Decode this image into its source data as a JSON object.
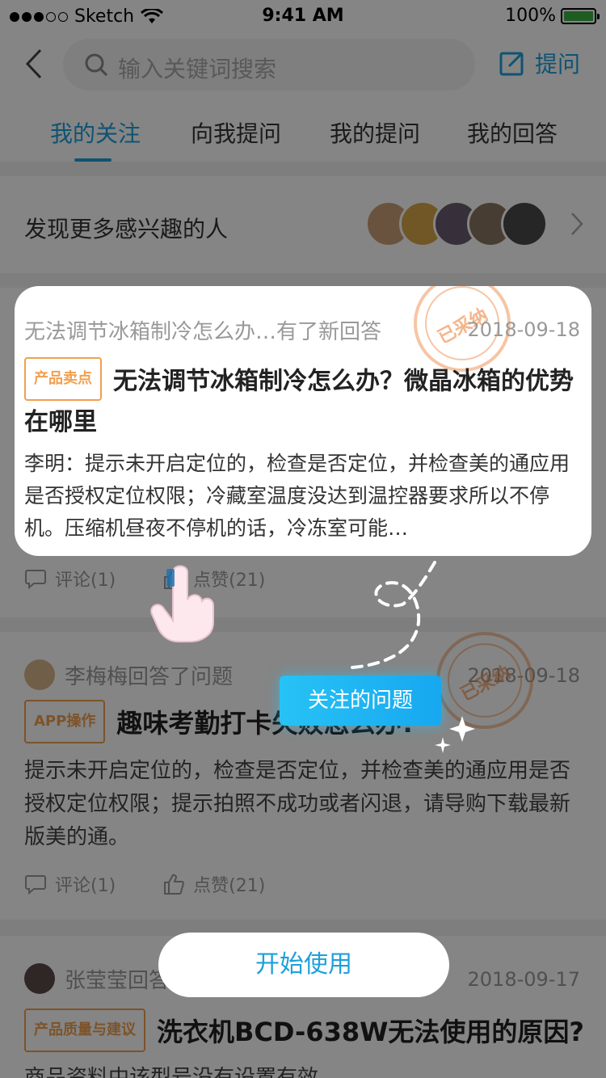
{
  "status_bar": {
    "carrier": "Sketch",
    "time": "9:41 AM",
    "battery": "100%"
  },
  "header": {
    "search_placeholder": "输入关键词搜索",
    "ask_label": "提问"
  },
  "tabs": [
    {
      "label": "我的关注",
      "active": true
    },
    {
      "label": "向我提问",
      "active": false
    },
    {
      "label": "我的提问",
      "active": false
    },
    {
      "label": "我的回答",
      "active": false
    }
  ],
  "discover": {
    "label": "发现更多感兴趣的人"
  },
  "feed": [
    {
      "head": "无法调节冰箱制冷怎么办…有了新回答",
      "date": "2018-09-18",
      "tag": "产品卖点",
      "title": "无法调节冰箱制冷怎么办？微晶冰箱的优势在哪里",
      "body": "李明：提示未开启定位的，检查是否定位，并检查美的通应用是否授权定位权限；冷藏室温度没达到温控器要求所以不停机。压缩机昼夜不停机的话，冷冻室可能…",
      "comments": "评论(1)",
      "likes": "点赞(21)",
      "stamp": "已采纳"
    },
    {
      "head": "李梅梅回答了问题",
      "date": "2018-09-18",
      "tag": "APP操作",
      "title": "趣味考勤打卡失败怎么办?",
      "body": "提示未开启定位的，检查是否定位，并检查美的通应用是否授权定位权限；提示拍照不成功或者闪退，请导购下载最新版美的通。",
      "comments": "评论(1)",
      "likes": "点赞(21)",
      "stamp": "已采纳"
    },
    {
      "head": "张莹莹回答了问题",
      "date": "2018-09-17",
      "tag": "产品质量与建议",
      "title": "洗衣机BCD-638W无法使用的原因?",
      "body": "商品资料中该型号没有设置有效"
    }
  ],
  "guide": {
    "hint_label": "关注的问题",
    "start_label": "开始使用"
  },
  "colors": {
    "accent": "#1e9fdc",
    "tag": "#f0a050",
    "hint": "#27c2f5"
  }
}
